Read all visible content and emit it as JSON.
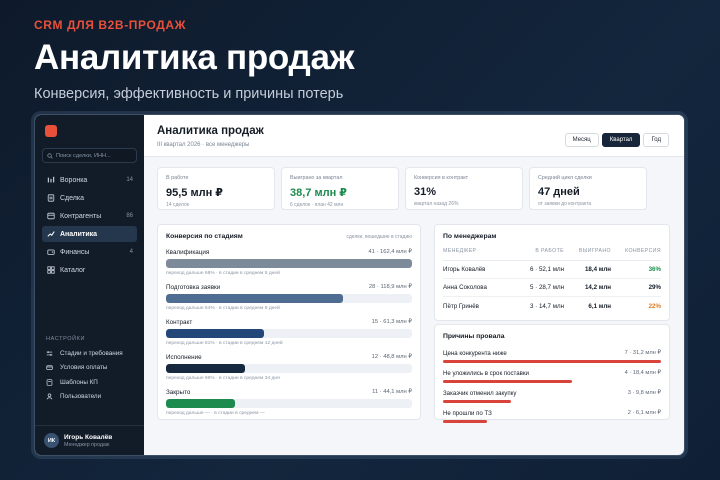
{
  "hero": {
    "eyebrow": "CRM ДЛЯ B2B-ПРОДАЖ",
    "title": "Аналитика продаж",
    "subtitle": "Конверсия, эффективность и причины потерь"
  },
  "sidebar": {
    "search_placeholder": "Поиск сделки, ИНН...",
    "items": [
      {
        "label": "Воронка",
        "count": "14",
        "icon": "funnel-icon"
      },
      {
        "label": "Сделка",
        "count": "",
        "icon": "document-icon"
      },
      {
        "label": "Контрагенты",
        "count": "86",
        "icon": "people-icon"
      },
      {
        "label": "Аналитика",
        "count": "",
        "icon": "chart-icon",
        "active": true
      },
      {
        "label": "Финансы",
        "count": "4",
        "icon": "wallet-icon"
      },
      {
        "label": "Каталог",
        "count": "",
        "icon": "grid-icon"
      }
    ],
    "settings_title": "НАСТРОЙКИ",
    "settings": [
      {
        "label": "Стадии и требования",
        "icon": "sliders-icon"
      },
      {
        "label": "Условия оплаты",
        "icon": "card-icon"
      },
      {
        "label": "Шаблоны КП",
        "icon": "template-icon"
      },
      {
        "label": "Пользователи",
        "icon": "user-icon"
      }
    ],
    "user": {
      "initials": "ИК",
      "name": "Игорь Ковалёв",
      "role": "Менеджер продаж"
    }
  },
  "header": {
    "title": "Аналитика продаж",
    "subtitle": "III квартал 2026 · все менеджеры",
    "periods": [
      {
        "label": "Месяц",
        "active": false
      },
      {
        "label": "Квартал",
        "active": true
      },
      {
        "label": "Год",
        "active": false
      }
    ]
  },
  "kpis": [
    {
      "label": "В работе",
      "value": "95,5 млн ₽",
      "hint": "14 сделок"
    },
    {
      "label": "Выиграно за квартал",
      "value": "38,7 млн ₽",
      "hint": "6 сделок · план 42 млн"
    },
    {
      "label": "Конверсия в контракт",
      "value": "31%",
      "hint": "квартал назад 26%"
    },
    {
      "label": "Средний цикл сделки",
      "value": "47 дней",
      "hint": "от заявки до контракта"
    }
  ],
  "funnel": {
    "title": "Конверсия по стадиям",
    "note": "сделки, вошедшие в стадию",
    "stages": [
      {
        "name": "Квалификация",
        "value": "41 · 162,4 млн ₽",
        "share": 1.0,
        "color": "#7d8a99",
        "hint": "переход дальше 68% · в стадии в среднем 5 дней"
      },
      {
        "name": "Подготовка заявки",
        "value": "28 · 118,9 млн ₽",
        "share": 0.72,
        "color": "#4f6d92",
        "hint": "переход дальше 54% · в стадии в среднем 8 дней"
      },
      {
        "name": "Контракт",
        "value": "15 · 61,3 млн ₽",
        "share": 0.4,
        "color": "#24477a",
        "hint": "переход дальше 81% · в стадии в среднем 12 дней"
      },
      {
        "name": "Исполнение",
        "value": "12 · 48,8 млн ₽",
        "share": 0.32,
        "color": "#17293e",
        "hint": "переход дальше 96% · в стадии в среднем 34 дня"
      },
      {
        "name": "Закрыто",
        "value": "11 · 44,1 млн ₽",
        "share": 0.28,
        "color": "#1d8a4e",
        "hint": "переход дальше — · в стадии в среднем —"
      }
    ]
  },
  "managers": {
    "title": "По менеджерам",
    "columns": [
      "МЕНЕДЖЕР",
      "В РАБОТЕ",
      "ВЫИГРАНО",
      "КОНВЕРСИЯ"
    ],
    "rows": [
      {
        "name": "Игорь Ковалёв",
        "in_work": "6 · 52,1 млн",
        "won": "18,4 млн",
        "conversion": "36%",
        "color": "#1d8a4e"
      },
      {
        "name": "Анна Соколова",
        "in_work": "5 · 28,7 млн",
        "won": "14,2 млн",
        "conversion": "29%",
        "color": "#141c26"
      },
      {
        "name": "Пётр Гринёв",
        "in_work": "3 · 14,7 млн",
        "won": "6,1 млн",
        "conversion": "22%",
        "color": "#e07a1f"
      }
    ]
  },
  "reasons": {
    "title": "Причины провала",
    "items": [
      {
        "name": "Цена конкурента ниже",
        "value": "7 · 31,2 млн ₽",
        "share": 1.0
      },
      {
        "name": "Не уложились в срок поставки",
        "value": "4 · 18,4 млн ₽",
        "share": 0.59
      },
      {
        "name": "Заказчик отменил закупку",
        "value": "3 · 9,8 млн ₽",
        "share": 0.31
      },
      {
        "name": "Не прошли по ТЗ",
        "value": "2 · 6,1 млн ₽",
        "share": 0.2
      }
    ]
  }
}
